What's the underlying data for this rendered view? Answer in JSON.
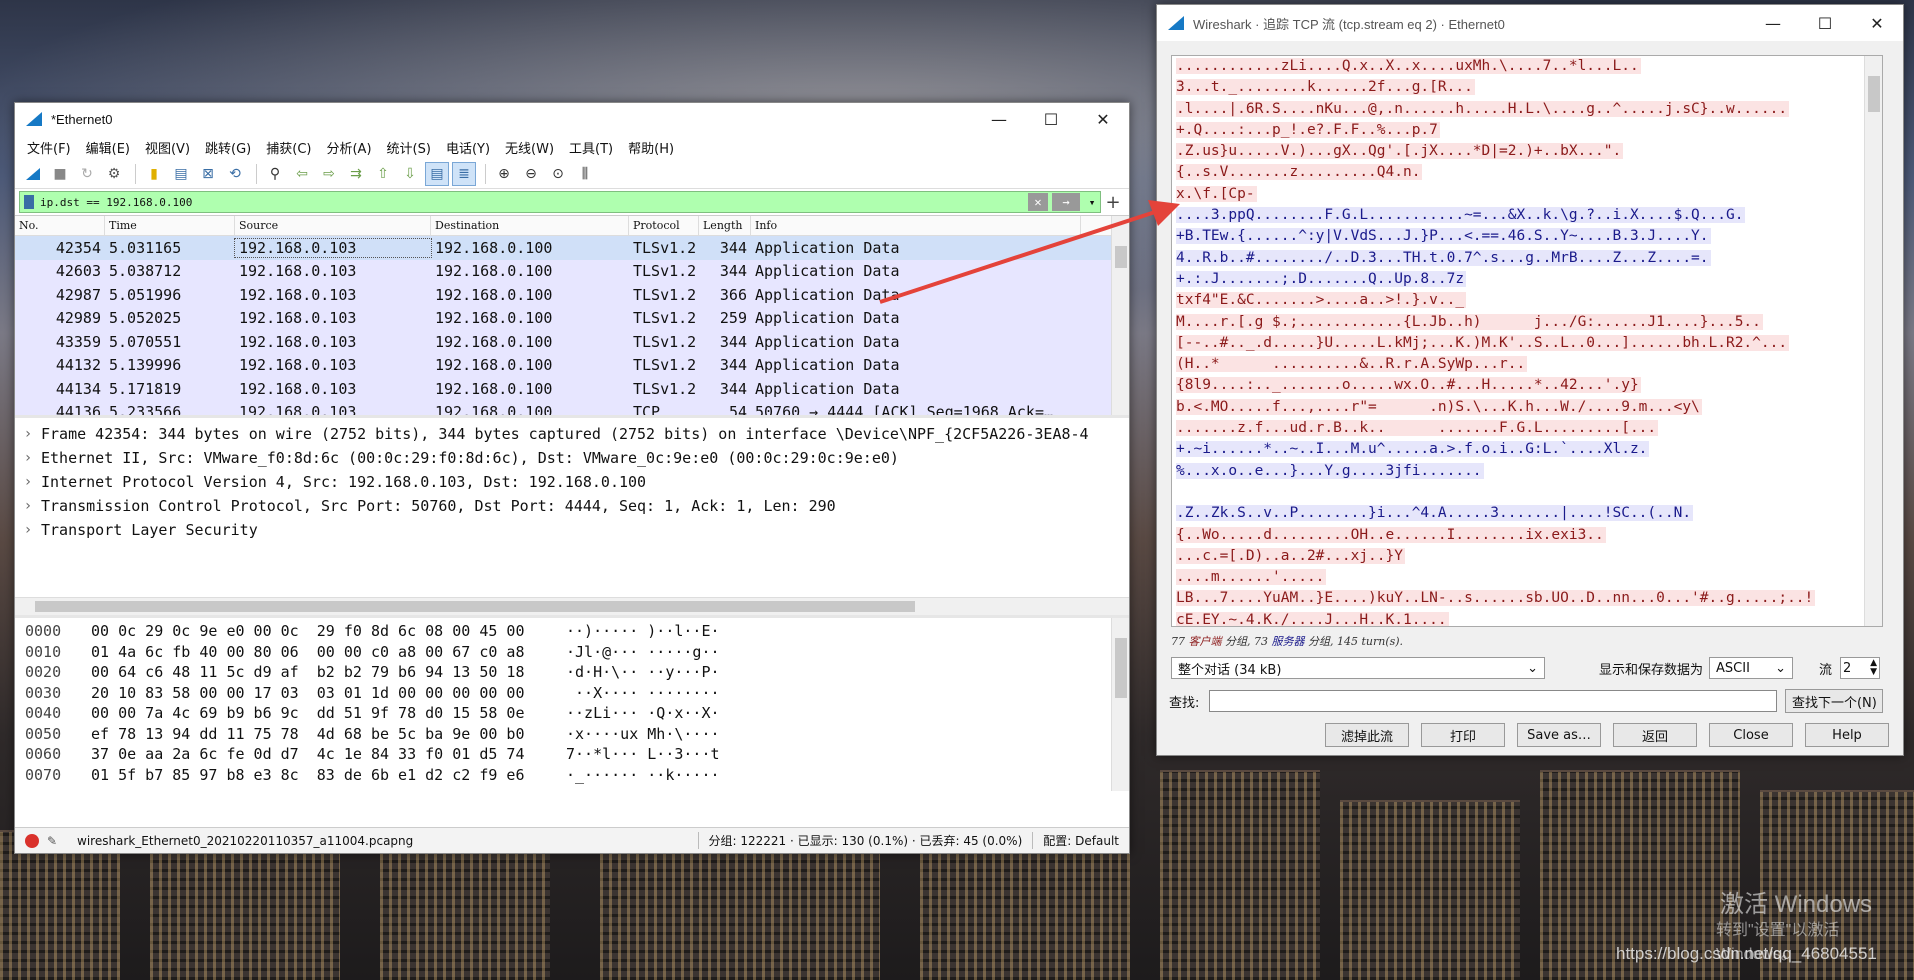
{
  "desktop": {
    "watermark_line1": "激活 Windows",
    "watermark_line2": "转到\"设置\"以激活 Windows。",
    "watermark_url": "https://blog.csdn.net/qq_46804551"
  },
  "main": {
    "title": "*Ethernet0",
    "controls": {
      "minimize": "—",
      "maximize": "☐",
      "close": "✕"
    },
    "menus": [
      "文件(F)",
      "编辑(E)",
      "视图(V)",
      "跳转(G)",
      "捕获(C)",
      "分析(A)",
      "统计(S)",
      "电话(Y)",
      "无线(W)",
      "工具(T)",
      "帮助(H)"
    ],
    "filter": {
      "value": "ip.dst == 192.168.0.100",
      "clear": "✕",
      "apply": "→",
      "dropdown": "▾",
      "add": "+"
    },
    "columns": [
      "No.",
      "Time",
      "Source",
      "Destination",
      "Protocol",
      "Length",
      "Info"
    ],
    "packets": [
      {
        "no": "42354",
        "time": "5.031165",
        "src": "192.168.0.103",
        "dst": "192.168.0.100",
        "proto": "TLSv1.2",
        "len": "344",
        "info": "Application Data"
      },
      {
        "no": "42603",
        "time": "5.038712",
        "src": "192.168.0.103",
        "dst": "192.168.0.100",
        "proto": "TLSv1.2",
        "len": "344",
        "info": "Application Data"
      },
      {
        "no": "42987",
        "time": "5.051996",
        "src": "192.168.0.103",
        "dst": "192.168.0.100",
        "proto": "TLSv1.2",
        "len": "366",
        "info": "Application Data"
      },
      {
        "no": "42989",
        "time": "5.052025",
        "src": "192.168.0.103",
        "dst": "192.168.0.100",
        "proto": "TLSv1.2",
        "len": "259",
        "info": "Application Data"
      },
      {
        "no": "43359",
        "time": "5.070551",
        "src": "192.168.0.103",
        "dst": "192.168.0.100",
        "proto": "TLSv1.2",
        "len": "344",
        "info": "Application Data"
      },
      {
        "no": "44132",
        "time": "5.139996",
        "src": "192.168.0.103",
        "dst": "192.168.0.100",
        "proto": "TLSv1.2",
        "len": "344",
        "info": "Application Data"
      },
      {
        "no": "44134",
        "time": "5.171819",
        "src": "192.168.0.103",
        "dst": "192.168.0.100",
        "proto": "TLSv1.2",
        "len": "344",
        "info": "Application Data"
      },
      {
        "no": "44136",
        "time": "5.233566",
        "src": "192.168.0.103",
        "dst": "192.168.0.100",
        "proto": "TCP",
        "len": "54",
        "info": "50760 → 4444 [ACK] Seq=1968 Ack=…"
      }
    ],
    "details": [
      "Frame 42354: 344 bytes on wire (2752 bits), 344 bytes captured (2752 bits) on interface \\Device\\NPF_{2CF5A226-3EA8-4",
      "Ethernet II, Src: VMware_f0:8d:6c (00:0c:29:f0:8d:6c), Dst: VMware_0c:9e:e0 (00:0c:29:0c:9e:e0)",
      "Internet Protocol Version 4, Src: 192.168.0.103, Dst: 192.168.0.100",
      "Transmission Control Protocol, Src Port: 50760, Dst Port: 4444, Seq: 1, Ack: 1, Len: 290",
      "Transport Layer Security"
    ],
    "bytes": [
      {
        "off": "0000",
        "hex": "00 0c 29 0c 9e e0 00 0c  29 f0 8d 6c 08 00 45 00",
        "asc": "··)····· )··l··E·"
      },
      {
        "off": "0010",
        "hex": "01 4a 6c fb 40 00 80 06  00 00 c0 a8 00 67 c0 a8",
        "asc": "·Jl·@··· ·····g··"
      },
      {
        "off": "0020",
        "hex": "00 64 c6 48 11 5c d9 af  b2 b2 79 b6 94 13 50 18",
        "asc": "·d·H·\\·· ··y···P·"
      },
      {
        "off": "0030",
        "hex": "20 10 83 58 00 00 17 03  03 01 1d 00 00 00 00 00",
        "asc": " ··X···· ········"
      },
      {
        "off": "0040",
        "hex": "00 00 7a 4c 69 b9 b6 9c  dd 51 9f 78 d0 15 58 0e",
        "asc": "··zLi··· ·Q·x··X·"
      },
      {
        "off": "0050",
        "hex": "ef 78 13 94 dd 11 75 78  4d 68 be 5c ba 9e 00 b0",
        "asc": "·x····ux Mh·\\····"
      },
      {
        "off": "0060",
        "hex": "37 0e aa 2a 6c fe 0d d7  4c 1e 84 33 f0 01 d5 74",
        "asc": "7··*l··· L··3···t"
      },
      {
        "off": "0070",
        "hex": "01 5f b7 85 97 b8 e3 8c  83 de 6b e1 d2 c2 f9 e6",
        "asc": "·_······ ··k·····"
      }
    ],
    "status": {
      "file": "wireshark_Ethernet0_20210220110357_a11004.pcapng",
      "packets": "分组: 122221 · 已显示: 130 (0.1%) · 已丢弃: 45 (0.0%)",
      "profile": "配置: Default"
    }
  },
  "stream": {
    "title": "Wireshark · 追踪 TCP 流 (tcp.stream eq 2) · Ethernet0",
    "lines": [
      {
        "t": "c",
        "s": "............zLi....Q.x..X..x....uxMh.\\....7..*l...L.."
      },
      {
        "t": "c",
        "s": "3...t._........k......2f...g.[R..."
      },
      {
        "t": "c",
        "s": ".l....|.6R.S....nKu...@,.n......h.....H.L.\\....g..^.....j.sC}..w......"
      },
      {
        "t": "c",
        "s": "+.Q....:...p_!.e?.F.F..%...p.7"
      },
      {
        "t": "c",
        "s": ".Z.us}u.....V.)...gX..Qg'.[.jX....*D|=2.)+..bX...\"."
      },
      {
        "t": "c",
        "s": "{..s.V.......z.........Q4.n."
      },
      {
        "t": "c",
        "s": "x.\\f.[Cp-"
      },
      {
        "t": "s",
        "s": "....3.ppQ........F.G.L...........~=...&X..k.\\g.?..i.X....$.Q...G."
      },
      {
        "t": "s",
        "s": "+B.TEw.{......^:y|V.VdS...J.}P...<.==.46.S..Y~....B.3.J....Y."
      },
      {
        "t": "s",
        "s": "4..R.b..#......../..D.3...TH.t.0.7^.s...g..MrB....Z...Z....=."
      },
      {
        "t": "s",
        "s": "+.:.J.......;.D.......Q..Up.8..7z"
      },
      {
        "t": "c",
        "s": "txf4\"E.&C.......>....a..>!.}.v.._"
      },
      {
        "t": "c",
        "s": "M....r.[.g $.;............{L.Jb..h)      j.../G:......J1....}...5.."
      },
      {
        "t": "c",
        "s": "[--..#.._.d.....}U.....L.kMj;...K.)M.K'..S..L..0...]......bh.L.R2.^..."
      },
      {
        "t": "c",
        "s": "(H..*      ..........&..R.r.A.SyWp...r.."
      },
      {
        "t": "c",
        "s": "{8l9....:.._.......o.....wx.O..#...H.....*..42...'.y}"
      },
      {
        "t": "c",
        "s": "b.<.MO.....f...,....r\"=      .n)S.\\...K.h...W./....9.m...<y\\"
      },
      {
        "t": "c",
        "s": ".......z.f...ud.r.B..k..      .......F.G.L.........[..."
      },
      {
        "t": "s",
        "s": "+.~i......*..~..I...M.u^.....a.>.f.o.i..G:L.`....Xl.z."
      },
      {
        "t": "s",
        "s": "%...x.o..e...}...Y.g....3jfi......."
      },
      {
        "t": "b",
        "s": ""
      },
      {
        "t": "s",
        "s": ".Z..Zk.S..v..P........}i...^4.A.....3.......|....!SC..(..N."
      },
      {
        "t": "c",
        "s": "{..Wo.....d.........OH..e......I........ix.exi3.."
      },
      {
        "t": "c",
        "s": "...c.=[.D)..a..2#...xj..}Y"
      },
      {
        "t": "c",
        "s": "....m......'....."
      },
      {
        "t": "c",
        "s": "LB...7....YuAM..}E....)kuY..LN-..s......sb.UO..D..nn...0...'#..g.....;..!"
      },
      {
        "t": "c",
        "s": "cE.EY.~.4.K./....J...H..K.1...."
      }
    ],
    "turns": {
      "client_count": "77",
      "client_label": "客户端",
      "sep1": " 分组, ",
      "server_count": "73",
      "server_label": "服务器",
      "rest": " 分组, 145 turn(s)."
    },
    "conversation": "整个对话 (34 kB)",
    "show_as_label": "显示和保存数据为",
    "show_as_value": "ASCII",
    "stream_label": "流",
    "stream_value": "2",
    "find_label": "查找:",
    "find_next": "查找下一个(N)",
    "buttons": {
      "filter_out": "滤掉此流",
      "print": "打印",
      "save_as": "Save as…",
      "back": "返回",
      "close": "Close",
      "help": "Help"
    }
  }
}
